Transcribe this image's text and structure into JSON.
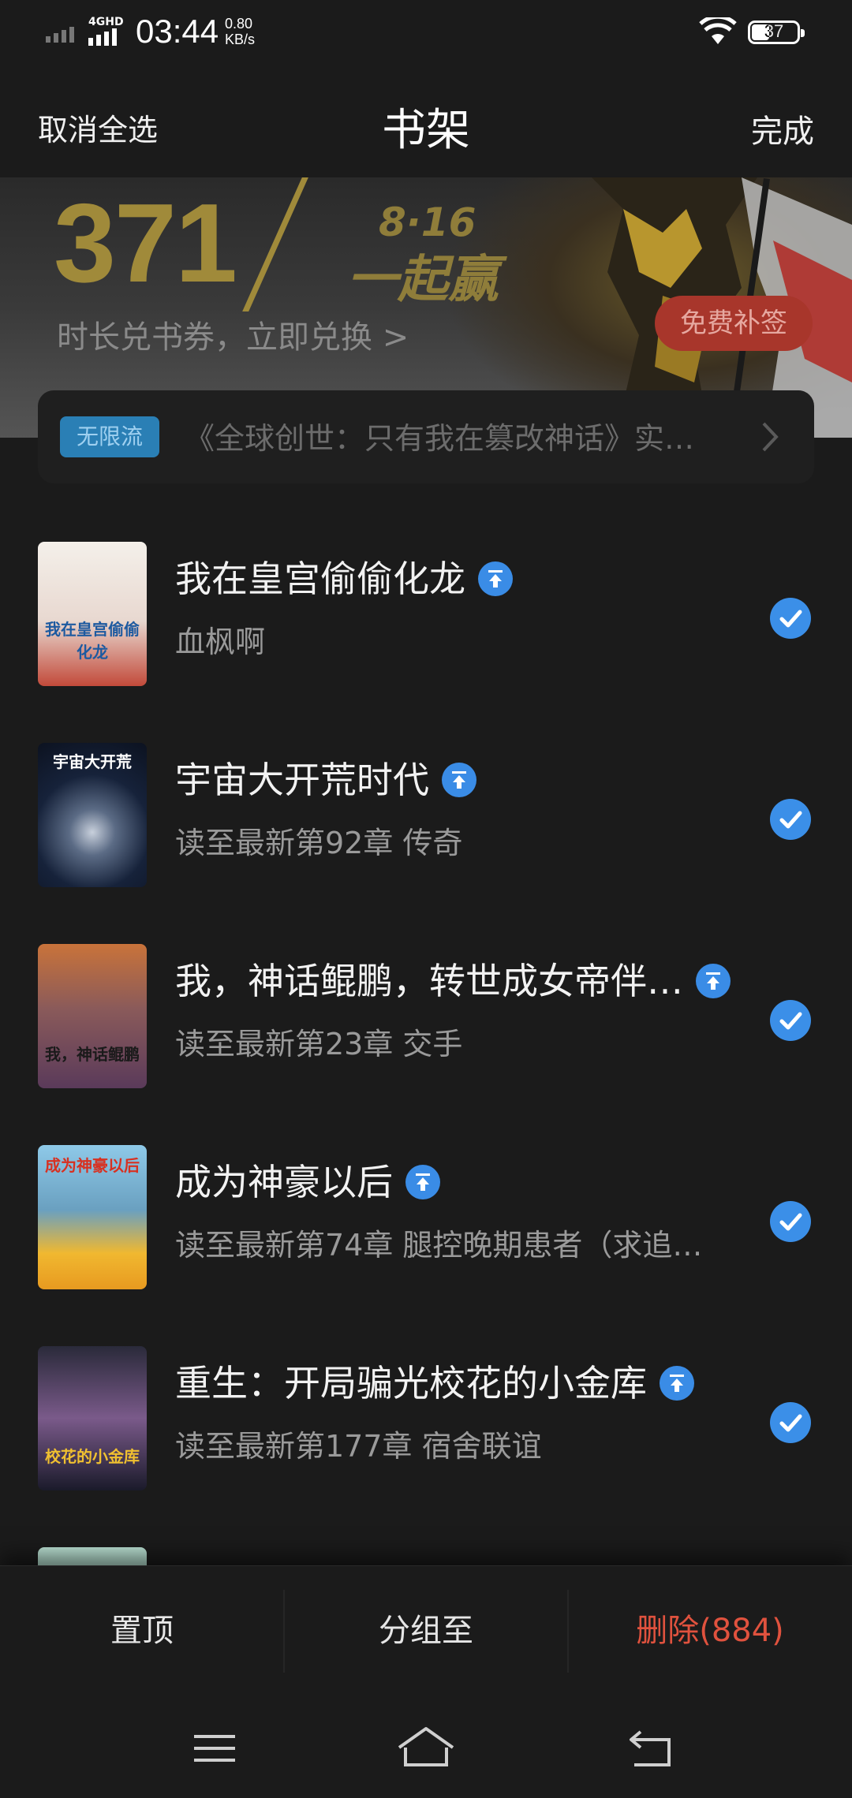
{
  "status_bar": {
    "network_type": "4GHD",
    "time": "03:44",
    "speed_value": "0.80",
    "speed_unit": "KB/s",
    "battery_level": "37",
    "battery_fraction": 0.37
  },
  "header": {
    "left_action": "取消全选",
    "title": "书架",
    "right_action": "完成"
  },
  "banner": {
    "big_number": "371",
    "date": "8·16",
    "slogan": "一起赢",
    "subtitle": "时长兑书券，立即兑换 >",
    "button_label": "免费补签",
    "button_color": "#a8362b"
  },
  "notice": {
    "tag": "无限流",
    "text": "《全球创世：只有我在篡改神话》实…"
  },
  "books": [
    {
      "title": "我在皇宫偷偷化龙",
      "subtitle": "血枫啊",
      "cover_text": "我在皇宫偷偷化龙",
      "cover_colors": [
        "#f4f0ea",
        "#c24a3a"
      ],
      "selected": true
    },
    {
      "title": "宇宙大开荒时代",
      "subtitle": "读至最新第92章 传奇",
      "cover_text": "宇宙大开荒",
      "cover_colors": [
        "#16223a",
        "#5b6b85"
      ],
      "selected": true
    },
    {
      "title": "我，神话鲲鹏，转世成女帝伴…",
      "subtitle": "读至最新第23章 交手",
      "cover_text": "我，神话鲲鹏",
      "cover_colors": [
        "#c9733a",
        "#5a3a5a"
      ],
      "selected": true
    },
    {
      "title": "成为神豪以后",
      "subtitle": "读至最新第74章 腿控晚期患者（求追…",
      "cover_text": "成为神豪以后",
      "cover_colors": [
        "#8ec9e8",
        "#f0b830"
      ],
      "selected": true
    },
    {
      "title": "重生：开局骗光校花的小金库",
      "subtitle": "读至最新第177章 宿舍联谊",
      "cover_text": "校花的小金库",
      "cover_colors": [
        "#2a2a3a",
        "#7a5a8a"
      ],
      "selected": true
    }
  ],
  "actions": {
    "pin_label": "置顶",
    "group_label": "分组至",
    "delete_label": "删除(884)",
    "delete_color": "#e0523e"
  },
  "navigation": {
    "icons": [
      "menu-icon",
      "home-icon",
      "back-icon"
    ]
  }
}
